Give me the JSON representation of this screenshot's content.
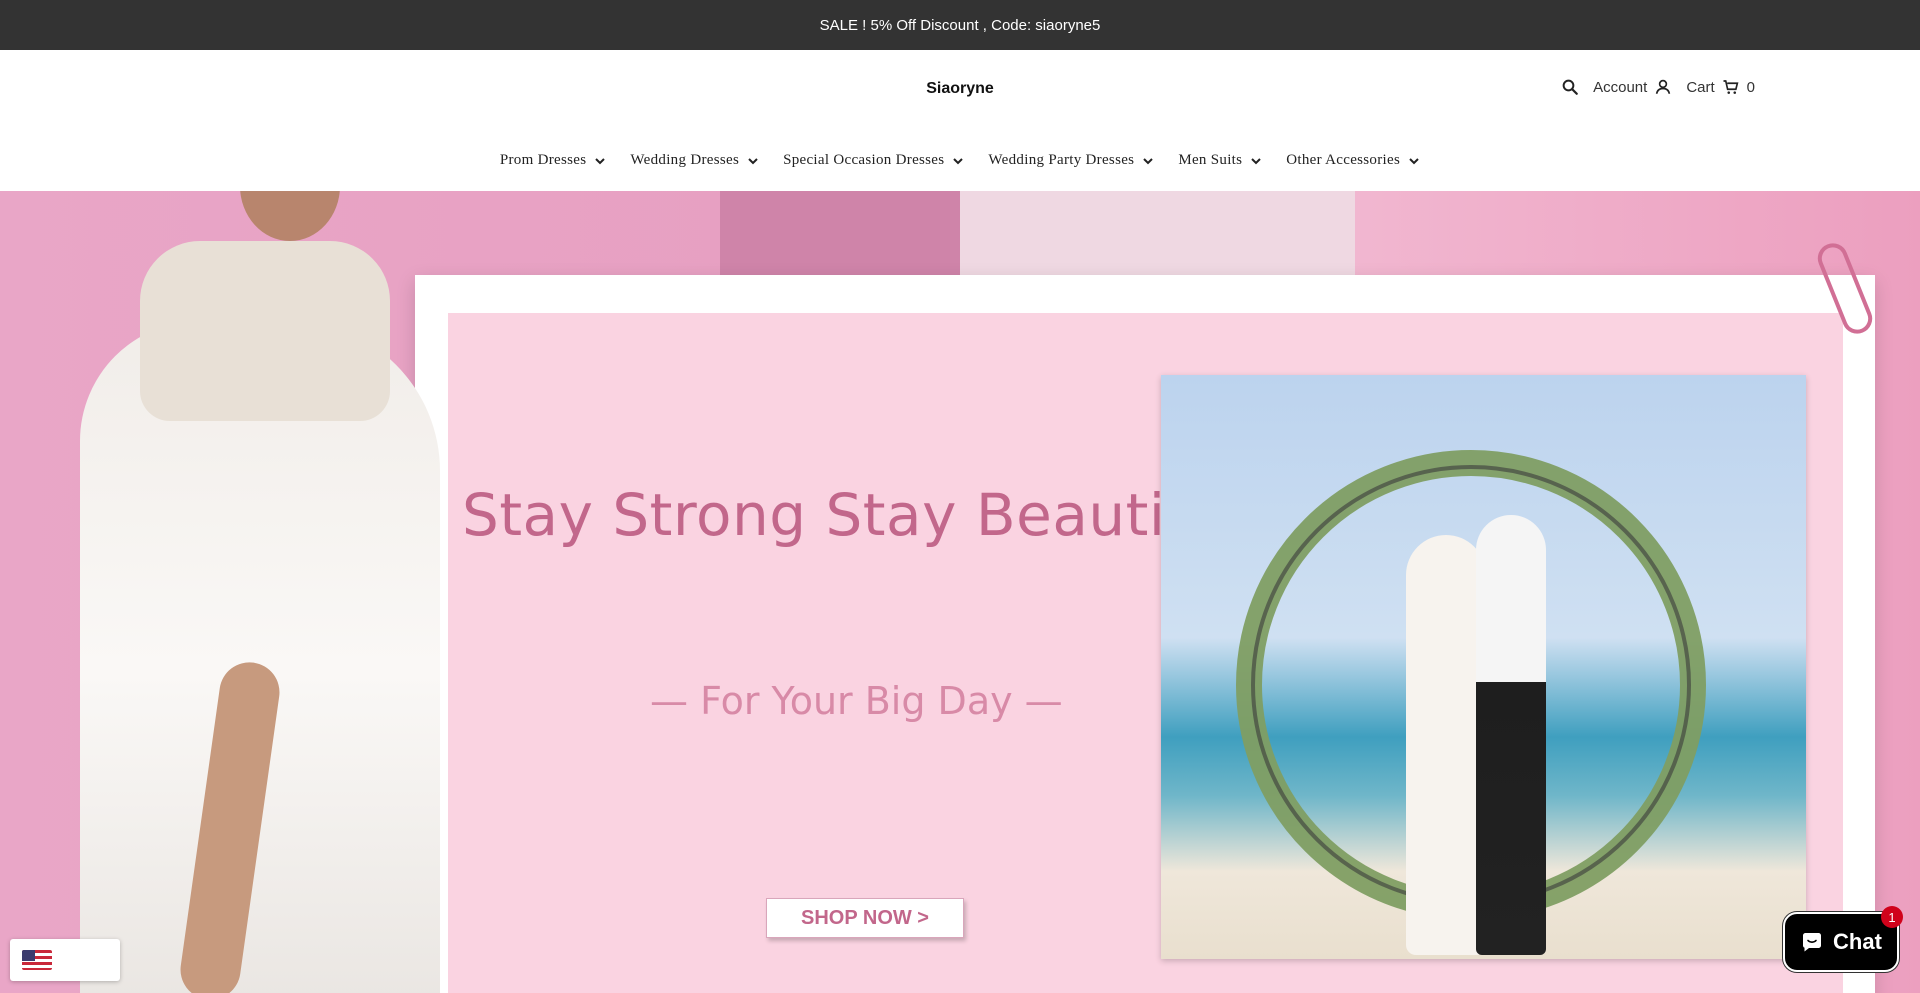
{
  "announcement": "SALE ! 5% Off Discount , Code: siaoryne5",
  "header": {
    "logo": "Siaoryne",
    "account_label": "Account",
    "cart_label": "Cart",
    "cart_count": "0"
  },
  "nav": {
    "items": [
      {
        "label": "Prom Dresses"
      },
      {
        "label": "Wedding Dresses"
      },
      {
        "label": "Special Occasion Dresses"
      },
      {
        "label": "Wedding Party Dresses"
      },
      {
        "label": "Men Suits"
      },
      {
        "label": "Other Accessories"
      }
    ]
  },
  "hero": {
    "title": "Stay Strong Stay Beautiful",
    "subtitle": "— For Your Big Day —",
    "button": "SHOP NOW >"
  },
  "chat": {
    "label": "Chat",
    "badge": "1"
  },
  "icons": {
    "search": "search-icon",
    "account": "user-icon",
    "cart": "cart-icon",
    "chevron": "chevron-down-icon",
    "chat": "chat-bubble-icon",
    "flag": "us-flag-icon"
  },
  "colors": {
    "announcement_bg": "#333333",
    "hero_text": "#c2678b",
    "hero_pink": "#fad3e1",
    "chat_bg": "#000000",
    "badge": "#d0021b"
  }
}
